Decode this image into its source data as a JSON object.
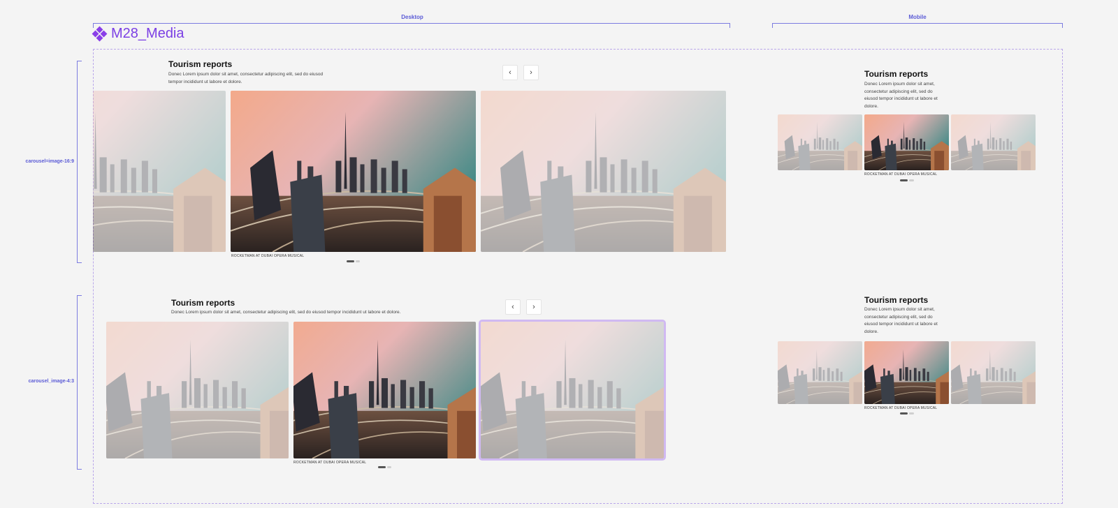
{
  "header": {
    "desktop_label": "Desktop",
    "mobile_label": "Mobile",
    "logo_text": "M28_Media"
  },
  "variants": {
    "v169": "carousel=image-16:9",
    "v43": "carousel_image-4:3"
  },
  "carousel": {
    "title": "Tourism reports",
    "description": "Donec Lorem ipsum dolor sit amet, consectetur adipiscing elit, sed do eiusod tempor incididunt ut labore et dolore.",
    "description_line1": "Donec Lorem ipsum dolor sit amet, consectetur adipiscing elit, sed do eiusod",
    "description_line2": "tempor incididunt ut labore et dolore.",
    "mobile_line1": "Donec Lorem ipsum dolor sit amet,",
    "mobile_line2": "consectetur adipiscing elit, sed do",
    "mobile_line3": "eiusod tempor incididunt ut labore et",
    "mobile_line4": "dolore.",
    "caption": "ROCKETMAN AT DUBAI OPERA MUSICAL",
    "prev_icon": "‹",
    "next_icon": "›"
  },
  "colors": {
    "accent": "#8f4ff0",
    "guide": "#7b7be0"
  }
}
